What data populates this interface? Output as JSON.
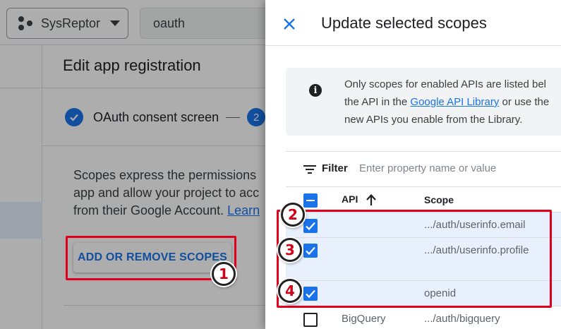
{
  "topbar": {
    "project_name": "SysReptor",
    "search_value": "oauth"
  },
  "page": {
    "title": "Edit app registration",
    "step1_label": "OAuth consent screen",
    "step2_number": "2",
    "desc_line1": "Scopes express the permissions",
    "desc_line2": "app and allow your project to acc",
    "desc_line3": "from their Google Account.",
    "learn_label": "Learn",
    "add_button_label": "ADD OR REMOVE SCOPES"
  },
  "panel": {
    "title": "Update selected scopes",
    "info": {
      "line1": "Only scopes for enabled APIs are listed bel",
      "line2_pre": "the API in the ",
      "line2_link": "Google API Library",
      "line2_post": " or use the",
      "line3": "new APIs you enable from the Library."
    },
    "filter_label": "Filter",
    "filter_placeholder": "Enter property name or value",
    "columns": {
      "api": "API",
      "scope": "Scope"
    },
    "rows": [
      {
        "api": "",
        "scope": ".../auth/userinfo.email",
        "checked": true
      },
      {
        "api": "",
        "scope": ".../auth/userinfo.profile",
        "checked": true
      },
      {
        "api": "",
        "scope": "openid",
        "checked": true
      },
      {
        "api": "BigQuery",
        "scope": ".../auth/bigquery",
        "checked": false
      }
    ]
  },
  "annotations": {
    "badge1": "1",
    "badge2": "2",
    "badge3": "3",
    "badge4": "4",
    "color": "#e0001b"
  },
  "colors": {
    "accent": "#1a73e8",
    "selected_row": "#e8f0fe"
  }
}
